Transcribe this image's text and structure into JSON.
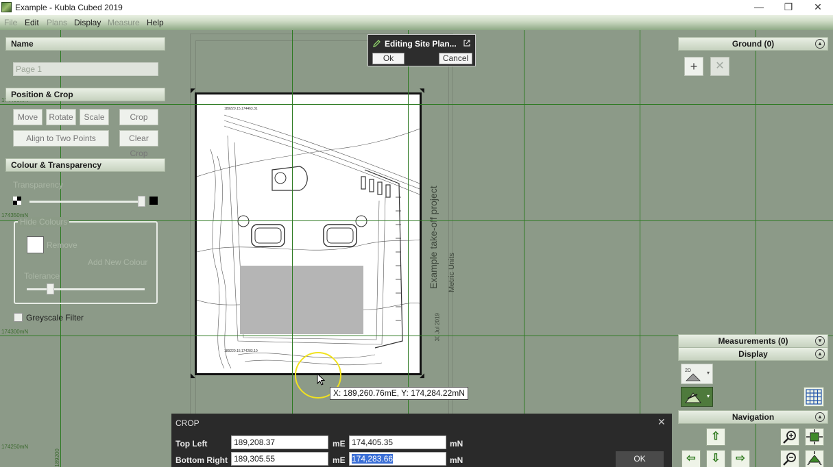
{
  "window": {
    "title": "Example - Kubla Cubed 2019",
    "minimize": "—",
    "restore": "❐",
    "close": "✕"
  },
  "menu": [
    "File",
    "Edit",
    "Plans",
    "Display",
    "Measure",
    "Help"
  ],
  "left_panel": {
    "name_header": "Name",
    "name_value": "Page 1",
    "position_header": "Position & Crop",
    "buttons": [
      "Move",
      "Rotate",
      "Scale",
      "Crop",
      "Align to Two Points",
      "Clear Crop"
    ],
    "colour_header": "Colour & Transparency",
    "transparency_label": "Transparency",
    "hide_colours_label": "Hide Colours",
    "remove_label": "Remove",
    "add_new_colour_label": "Add New Colour",
    "tolerance_label": "Tolerance",
    "greyscale_label": "Greyscale Filter"
  },
  "grid_labels": {
    "n1": "174400mN",
    "n2": "174350mN",
    "n3": "174300mN",
    "n4": "174250mN",
    "e1": "189200"
  },
  "editing_popup": {
    "title": "Editing Site Plan...",
    "ok": "Ok",
    "cancel": "Cancel"
  },
  "plan_text": {
    "title": "Example take-off project",
    "subtitle": "Metric Units",
    "date": "30 Jul 2019",
    "coord_top": "189220.15,174463.31",
    "coord_bottom": "189220.15,174283.10"
  },
  "tooltip": "X: 189,260.76mE, Y: 174,284.22mN",
  "crop_dialog": {
    "title": "CROP",
    "top_left_label": "Top Left",
    "bottom_right_label": "Bottom Right",
    "tl_e": "189,208.37",
    "tl_n": "174,405.35",
    "br_e": "189,305.55",
    "br_n": "174,283.66",
    "unit_e": "mE",
    "unit_n": "mN",
    "ok": "OK",
    "close": "✕"
  },
  "right_panel": {
    "ground_header": "Ground (0)",
    "measurements_header": "Measurements (0)",
    "display_header": "Display",
    "navigation_header": "Navigation",
    "add_icon": "+",
    "delete_icon": "✕"
  },
  "colors": {
    "grid": "#2d7a22",
    "panel": "#8b9a86",
    "dialog": "#2a2a2a"
  }
}
